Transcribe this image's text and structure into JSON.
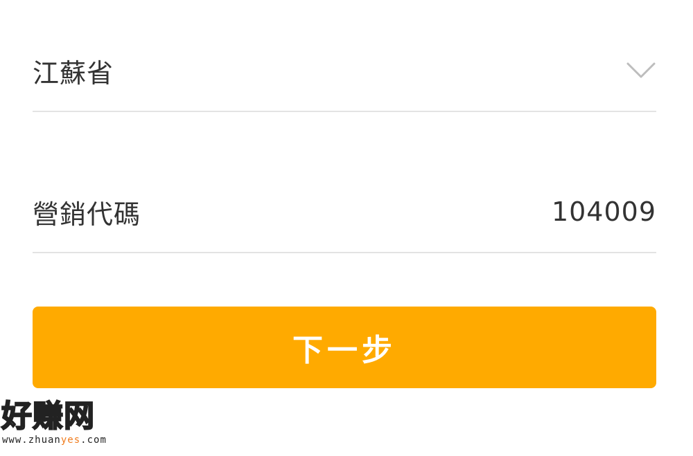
{
  "form": {
    "province": {
      "value": "江蘇省",
      "dropdown_icon": "chevron-down-icon"
    },
    "marketing_code": {
      "label": "營銷代碼",
      "value": "104009"
    },
    "next_button": {
      "label": "下一步"
    }
  },
  "watermark": {
    "logo_text": "好赚网",
    "url_prefix": "www.zhuan",
    "url_accent": "yes",
    "url_suffix": ".com"
  },
  "colors": {
    "accent": "#ffaa00",
    "divider": "#e3e3e3",
    "text": "#333333",
    "button_text": "#ffffff",
    "watermark_accent": "#f07c1e"
  }
}
